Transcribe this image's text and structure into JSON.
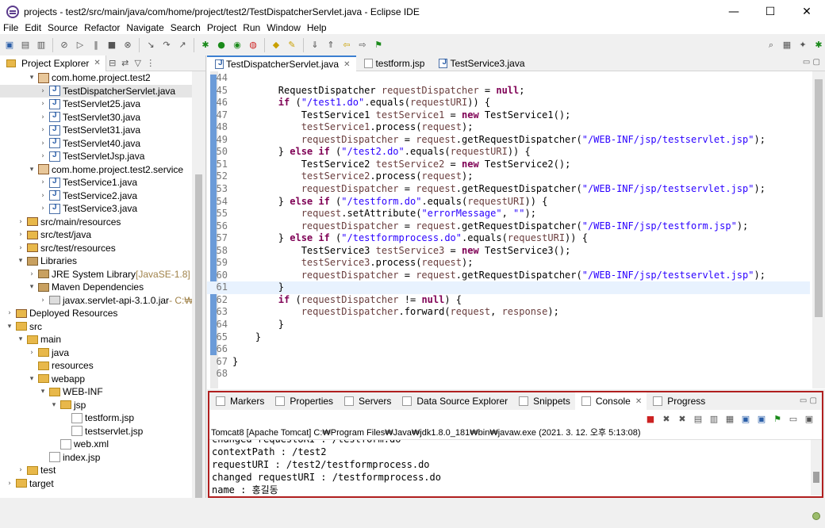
{
  "window": {
    "title": "projects - test2/src/main/java/com/home/project/test2/TestDispatcherServlet.java - Eclipse IDE",
    "minimize": "—",
    "maximize": "☐",
    "close": "✕"
  },
  "menu": [
    "File",
    "Edit",
    "Source",
    "Refactor",
    "Navigate",
    "Search",
    "Project",
    "Run",
    "Window",
    "Help"
  ],
  "toolbar_icons": [
    "new-icon",
    "save-icon",
    "print-icon",
    "debug-icon",
    "run-icon",
    "external-tools-icon",
    "search-icon",
    "perspective-icon"
  ],
  "project_explorer": {
    "title": "Project Explorer",
    "tree": [
      {
        "depth": 3,
        "tw": "▾",
        "icon": "pkg",
        "label": "com.home.project.test2"
      },
      {
        "depth": 4,
        "tw": "›",
        "icon": "java",
        "label": "TestDispatcherServlet.java",
        "selected": true
      },
      {
        "depth": 4,
        "tw": "›",
        "icon": "java",
        "label": "TestServlet25.java"
      },
      {
        "depth": 4,
        "tw": "›",
        "icon": "java",
        "label": "TestServlet30.java"
      },
      {
        "depth": 4,
        "tw": "›",
        "icon": "java",
        "label": "TestServlet31.java"
      },
      {
        "depth": 4,
        "tw": "›",
        "icon": "java",
        "label": "TestServlet40.java"
      },
      {
        "depth": 4,
        "tw": "›",
        "icon": "java",
        "label": "TestServletJsp.java"
      },
      {
        "depth": 3,
        "tw": "▾",
        "icon": "pkg",
        "label": "com.home.project.test2.service"
      },
      {
        "depth": 4,
        "tw": "›",
        "icon": "java",
        "label": "TestService1.java"
      },
      {
        "depth": 4,
        "tw": "›",
        "icon": "java",
        "label": "TestService2.java"
      },
      {
        "depth": 4,
        "tw": "›",
        "icon": "java",
        "label": "TestService3.java"
      },
      {
        "depth": 2,
        "tw": "›",
        "icon": "srcf",
        "label": "src/main/resources"
      },
      {
        "depth": 2,
        "tw": "›",
        "icon": "srcf",
        "label": "src/test/java"
      },
      {
        "depth": 2,
        "tw": "›",
        "icon": "srcf",
        "label": "src/test/resources"
      },
      {
        "depth": 2,
        "tw": "▾",
        "icon": "lib",
        "label": "Libraries"
      },
      {
        "depth": 3,
        "tw": "›",
        "icon": "lib",
        "label": "JRE System Library",
        "deco": "[JavaSE-1.8]"
      },
      {
        "depth": 3,
        "tw": "▾",
        "icon": "lib",
        "label": "Maven Dependencies"
      },
      {
        "depth": 4,
        "tw": "›",
        "icon": "jar",
        "label": "javax.servlet-api-3.1.0.jar",
        "deco": " - C:₩U"
      },
      {
        "depth": 1,
        "tw": "›",
        "icon": "srcf",
        "label": "Deployed Resources"
      },
      {
        "depth": 1,
        "tw": "▾",
        "icon": "fold",
        "label": "src"
      },
      {
        "depth": 2,
        "tw": "▾",
        "icon": "fold",
        "label": "main"
      },
      {
        "depth": 3,
        "tw": "›",
        "icon": "fold",
        "label": "java"
      },
      {
        "depth": 3,
        "tw": "",
        "icon": "fold",
        "label": "resources"
      },
      {
        "depth": 3,
        "tw": "▾",
        "icon": "fold",
        "label": "webapp"
      },
      {
        "depth": 4,
        "tw": "▾",
        "icon": "fold",
        "label": "WEB-INF"
      },
      {
        "depth": 5,
        "tw": "▾",
        "icon": "fold",
        "label": "jsp"
      },
      {
        "depth": 6,
        "tw": "",
        "icon": "file",
        "label": "testform.jsp"
      },
      {
        "depth": 6,
        "tw": "",
        "icon": "file",
        "label": "testservlet.jsp"
      },
      {
        "depth": 5,
        "tw": "",
        "icon": "file",
        "label": "web.xml"
      },
      {
        "depth": 4,
        "tw": "",
        "icon": "file",
        "label": "index.jsp"
      },
      {
        "depth": 2,
        "tw": "›",
        "icon": "fold",
        "label": "test"
      },
      {
        "depth": 1,
        "tw": "›",
        "icon": "fold",
        "label": "target"
      }
    ]
  },
  "editor": {
    "tabs": [
      {
        "label": "TestDispatcherServlet.java",
        "active": true,
        "close": "✕"
      },
      {
        "label": "testform.jsp",
        "active": false
      },
      {
        "label": "TestService3.java",
        "active": false
      }
    ],
    "lines": [
      {
        "n": "44",
        "t": []
      },
      {
        "n": "45",
        "t": [
          [
            "",
            "        RequestDispatcher "
          ],
          [
            "var",
            "requestDispatcher"
          ],
          [
            "",
            " = "
          ],
          [
            "kw",
            "null"
          ],
          [
            "",
            ";"
          ]
        ]
      },
      {
        "n": "46",
        "t": [
          [
            "kw",
            "        if"
          ],
          [
            "",
            " ("
          ],
          [
            "str",
            "\"/test1.do\""
          ],
          [
            "",
            ".equals("
          ],
          [
            "var",
            "requestURI"
          ],
          [
            "",
            ")) {"
          ]
        ]
      },
      {
        "n": "47",
        "t": [
          [
            "",
            "            TestService1 "
          ],
          [
            "var",
            "testService1"
          ],
          [
            "",
            " = "
          ],
          [
            "kw",
            "new"
          ],
          [
            "",
            " TestService1();"
          ]
        ]
      },
      {
        "n": "48",
        "t": [
          [
            "var",
            "            testService1"
          ],
          [
            "",
            ".process("
          ],
          [
            "var",
            "request"
          ],
          [
            "",
            ");"
          ]
        ]
      },
      {
        "n": "49",
        "t": [
          [
            "var",
            "            requestDispatcher"
          ],
          [
            "",
            " = "
          ],
          [
            "var",
            "request"
          ],
          [
            "",
            ".getRequestDispatcher("
          ],
          [
            "str",
            "\"/WEB-INF/jsp/testservlet.jsp\""
          ],
          [
            "",
            ");"
          ]
        ]
      },
      {
        "n": "50",
        "t": [
          [
            "",
            "        } "
          ],
          [
            "kw",
            "else if"
          ],
          [
            "",
            " ("
          ],
          [
            "str",
            "\"/test2.do\""
          ],
          [
            "",
            ".equals("
          ],
          [
            "var",
            "requestURI"
          ],
          [
            "",
            ")) {"
          ]
        ]
      },
      {
        "n": "51",
        "t": [
          [
            "",
            "            TestService2 "
          ],
          [
            "var",
            "testService2"
          ],
          [
            "",
            " = "
          ],
          [
            "kw",
            "new"
          ],
          [
            "",
            " TestService2();"
          ]
        ]
      },
      {
        "n": "52",
        "t": [
          [
            "var",
            "            testService2"
          ],
          [
            "",
            ".process("
          ],
          [
            "var",
            "request"
          ],
          [
            "",
            ");"
          ]
        ]
      },
      {
        "n": "53",
        "t": [
          [
            "var",
            "            requestDispatcher"
          ],
          [
            "",
            " = "
          ],
          [
            "var",
            "request"
          ],
          [
            "",
            ".getRequestDispatcher("
          ],
          [
            "str",
            "\"/WEB-INF/jsp/testservlet.jsp\""
          ],
          [
            "",
            ");"
          ]
        ]
      },
      {
        "n": "54",
        "t": [
          [
            "",
            "        } "
          ],
          [
            "kw",
            "else if"
          ],
          [
            "",
            " ("
          ],
          [
            "str",
            "\"/testform.do\""
          ],
          [
            "",
            ".equals("
          ],
          [
            "var",
            "requestURI"
          ],
          [
            "",
            ")) {"
          ]
        ]
      },
      {
        "n": "55",
        "t": [
          [
            "var",
            "            request"
          ],
          [
            "",
            ".setAttribute("
          ],
          [
            "str",
            "\"errorMessage\""
          ],
          [
            "",
            ", "
          ],
          [
            "str",
            "\"\""
          ],
          [
            "",
            ");"
          ]
        ]
      },
      {
        "n": "56",
        "t": [
          [
            "var",
            "            requestDispatcher"
          ],
          [
            "",
            " = "
          ],
          [
            "var",
            "request"
          ],
          [
            "",
            ".getRequestDispatcher("
          ],
          [
            "str",
            "\"/WEB-INF/jsp/testform.jsp\""
          ],
          [
            "",
            ");"
          ]
        ]
      },
      {
        "n": "57",
        "t": [
          [
            "",
            "        } "
          ],
          [
            "kw",
            "else if"
          ],
          [
            "",
            " ("
          ],
          [
            "str",
            "\"/testformprocess.do\""
          ],
          [
            "",
            ".equals("
          ],
          [
            "var",
            "requestURI"
          ],
          [
            "",
            ")) {"
          ]
        ]
      },
      {
        "n": "58",
        "t": [
          [
            "",
            "            TestService3 "
          ],
          [
            "var",
            "testService3"
          ],
          [
            "",
            " = "
          ],
          [
            "kw",
            "new"
          ],
          [
            "",
            " TestService3();"
          ]
        ]
      },
      {
        "n": "59",
        "t": [
          [
            "var",
            "            testService3"
          ],
          [
            "",
            ".process("
          ],
          [
            "var",
            "request"
          ],
          [
            "",
            ");"
          ]
        ]
      },
      {
        "n": "60",
        "t": [
          [
            "var",
            "            requestDispatcher"
          ],
          [
            "",
            " = "
          ],
          [
            "var",
            "request"
          ],
          [
            "",
            ".getRequestDispatcher("
          ],
          [
            "str",
            "\"/WEB-INF/jsp/testservlet.jsp\""
          ],
          [
            "",
            ");"
          ]
        ]
      },
      {
        "n": "61",
        "t": [
          [
            "",
            "        }"
          ]
        ],
        "cur": true
      },
      {
        "n": "62",
        "t": [
          [
            "kw",
            "        if"
          ],
          [
            "",
            " ("
          ],
          [
            "var",
            "requestDispatcher"
          ],
          [
            "",
            " != "
          ],
          [
            "kw",
            "null"
          ],
          [
            "",
            ") {"
          ]
        ]
      },
      {
        "n": "63",
        "t": [
          [
            "var",
            "            requestDispatcher"
          ],
          [
            "",
            ".forward("
          ],
          [
            "var",
            "request"
          ],
          [
            "",
            ", "
          ],
          [
            "var",
            "response"
          ],
          [
            "",
            ");"
          ]
        ]
      },
      {
        "n": "64",
        "t": [
          [
            "",
            "        }"
          ]
        ]
      },
      {
        "n": "65",
        "t": [
          [
            "",
            "    }"
          ]
        ]
      },
      {
        "n": "66",
        "t": []
      },
      {
        "n": "67",
        "t": [
          [
            "",
            "}"
          ]
        ]
      },
      {
        "n": "68",
        "t": []
      }
    ]
  },
  "bottom_panel": {
    "tabs": [
      {
        "label": "Markers",
        "icon": "markers-icon"
      },
      {
        "label": "Properties",
        "icon": "properties-icon"
      },
      {
        "label": "Servers",
        "icon": "servers-icon"
      },
      {
        "label": "Data Source Explorer",
        "icon": "data-source-icon"
      },
      {
        "label": "Snippets",
        "icon": "snippets-icon"
      },
      {
        "label": "Console",
        "icon": "console-icon",
        "active": true
      },
      {
        "label": "Progress",
        "icon": "progress-icon"
      }
    ],
    "console_title": "Tomcat8 [Apache Tomcat] C:₩Program Files₩Java₩jdk1.8.0_181₩bin₩javaw.exe  (2021. 3. 12. 오후 5:13:08)",
    "console_lines": [
      "changed requestURI : /testform.do",
      "contextPath : /test2",
      "requestURI : /test2/testformprocess.do",
      "changed requestURI : /testformprocess.do",
      "name : 홍길동"
    ]
  }
}
